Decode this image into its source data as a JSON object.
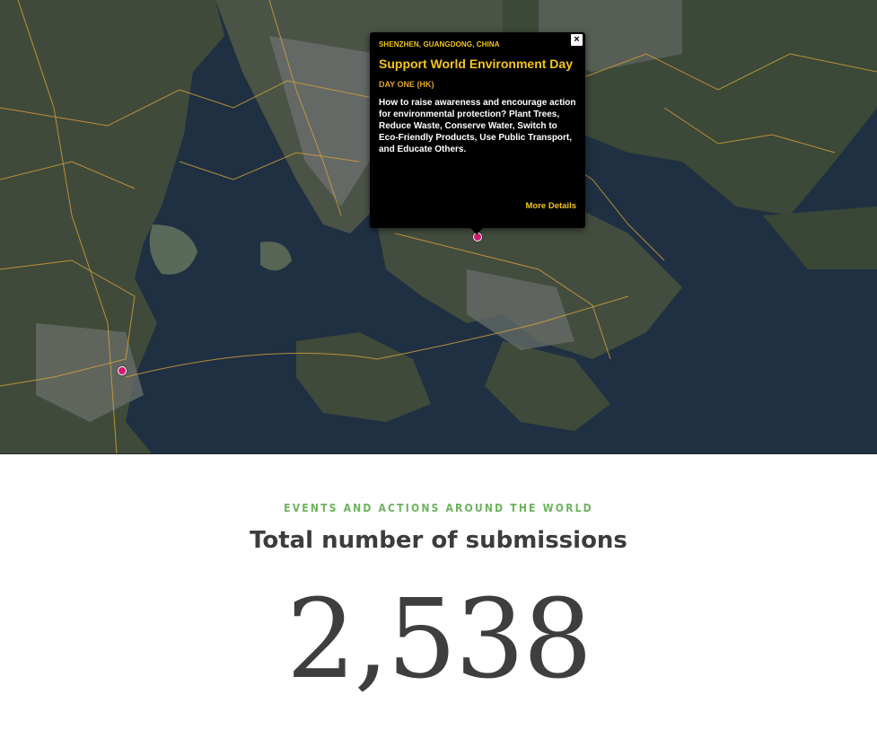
{
  "map": {
    "markers": [
      {
        "name": "marker-west",
        "color": "#d6186f"
      },
      {
        "name": "marker-shenzhen",
        "color": "#d6186f"
      }
    ],
    "colors": {
      "water": "#1e2f40",
      "land": "#3d4a3a",
      "roads": "#d9a43a"
    }
  },
  "popup": {
    "close_label": "×",
    "location": "SHENZHEN, GUANGDONG, CHINA",
    "title": "Support World Environment Day",
    "subtitle": "DAY ONE (HK)",
    "body": "How to raise awareness and encourage action for environmental protection? Plant Trees, Reduce Waste, Conserve Water, Switch to Eco-Friendly Products, Use Public Transport, and Educate Others.",
    "more_label": "More Details"
  },
  "stats": {
    "eyebrow": "EVENTS AND ACTIONS AROUND THE WORLD",
    "headline": "Total number of submissions",
    "count": "2,538"
  }
}
